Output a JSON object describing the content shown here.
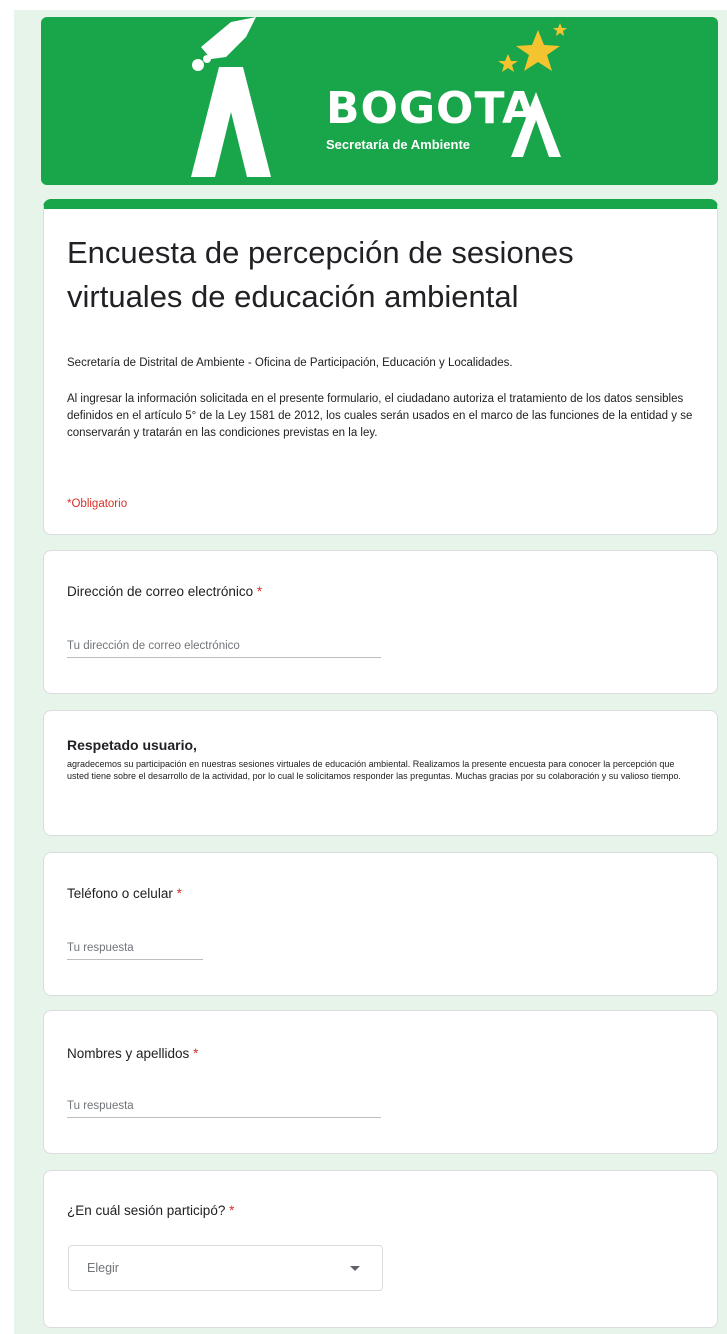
{
  "banner": {
    "brand": "BOGOTA",
    "subtitle": "Secretaría de Ambiente"
  },
  "form": {
    "title": "Encuesta de percepción de sesiones virtuales de educación ambiental",
    "org_line": "Secretaría de  Distrital de Ambiente - Oficina de Participación, Educación y Localidades.",
    "consent_text": "Al ingresar la información solicitada en el presente formulario, el ciudadano autoriza el tratamiento de los datos sensibles definidos en el artículo 5° de la Ley 1581 de 2012, los cuales serán usados en el marco de las funciones de la entidad y se conservarán y tratarán en las condiciones previstas en la ley.",
    "required_note": "*Obligatorio"
  },
  "email_question": {
    "label": "Dirección de correo electrónico",
    "required_mark": "*",
    "placeholder": "Tu dirección de correo electrónico"
  },
  "notice": {
    "title": "Respetado usuario,",
    "body": "agradecemos su participación en nuestras sesiones virtuales de educación ambiental. Realizamos la presente encuesta para conocer la percepción que usted tiene sobre el desarrollo de la actividad, por lo cual le solicitamos responder las preguntas. Muchas gracias por su colaboración y su valioso tiempo."
  },
  "phone_question": {
    "label": "Teléfono o celular",
    "required_mark": "*",
    "placeholder": "Tu respuesta"
  },
  "name_question": {
    "label": "Nombres y apellidos",
    "required_mark": "*",
    "placeholder": "Tu respuesta"
  },
  "session_question": {
    "label": "¿En cuál sesión participó?",
    "required_mark": "*",
    "select_value": "Elegir"
  },
  "colors": {
    "brand_green": "#19a54a",
    "page_bg": "#e6f4ea",
    "required_red": "#d93025",
    "star_yellow": "#f4c430"
  },
  "icons": {
    "logo": "bogota-logo-icon",
    "stars": "star-icon",
    "dropdown": "chevron-down-icon"
  }
}
